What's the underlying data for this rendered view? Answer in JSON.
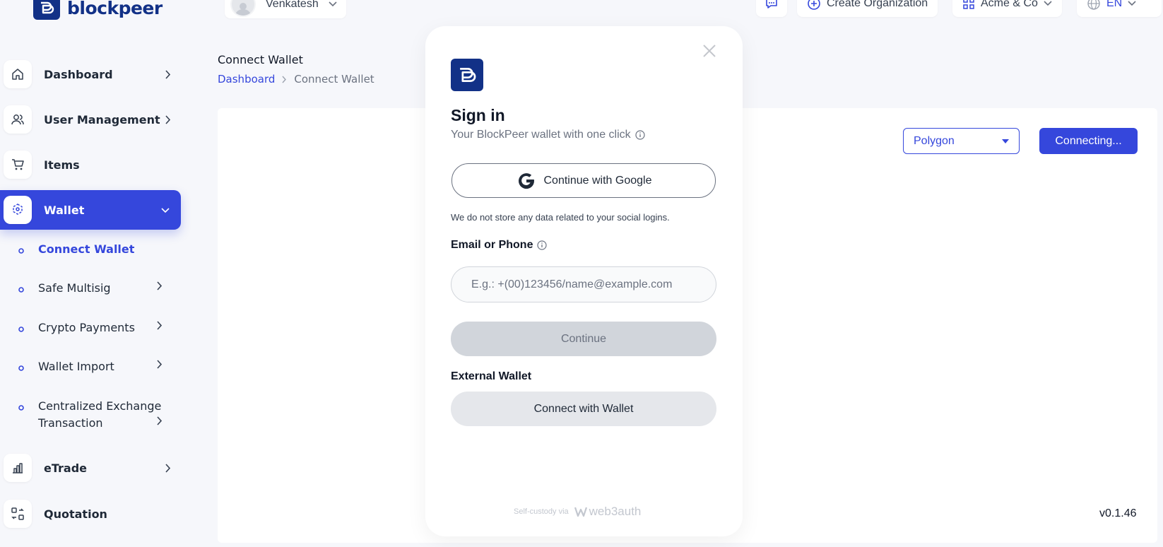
{
  "brand": {
    "name": "blockpeer"
  },
  "topbar": {
    "user_name": "Venkatesh",
    "create_org_label": "Create Organization",
    "org_name": "Acme & Co",
    "language": "EN"
  },
  "sidebar": {
    "items": [
      {
        "label": "Dashboard",
        "icon": "home-icon"
      },
      {
        "label": "User Management",
        "icon": "users-icon"
      },
      {
        "label": "Items",
        "icon": "cart-icon"
      },
      {
        "label": "Wallet",
        "icon": "wallet-icon"
      },
      {
        "label": "eTrade",
        "icon": "bar-chart-icon"
      },
      {
        "label": "Quotation",
        "icon": "swap-icon"
      }
    ],
    "wallet_subitems": [
      {
        "label": "Connect Wallet"
      },
      {
        "label": "Safe Multisig"
      },
      {
        "label": "Crypto Payments"
      },
      {
        "label": "Wallet Import"
      },
      {
        "label": "Centralized Exchange",
        "label2": "Transaction"
      }
    ]
  },
  "page": {
    "title": "Connect Wallet",
    "breadcrumb": [
      "Dashboard",
      "Connect Wallet"
    ],
    "network": "Polygon",
    "connect_button": "Connecting...",
    "version": "v0.1.46"
  },
  "modal": {
    "title": "Sign in",
    "subtitle": "Your BlockPeer wallet with one click",
    "google_button": "Continue with Google",
    "disclaimer": "We do not store any data related to your social logins.",
    "email_label": "Email or Phone",
    "email_placeholder": "E.g.: +(00)123456/name@example.com",
    "continue_button": "Continue",
    "external_wallet_label": "External Wallet",
    "connect_wallet_button": "Connect with Wallet",
    "footer_prefix": "Self-custody via",
    "footer_brand": "web3auth"
  },
  "colors": {
    "accent": "#3547dc",
    "brand": "#123187"
  }
}
